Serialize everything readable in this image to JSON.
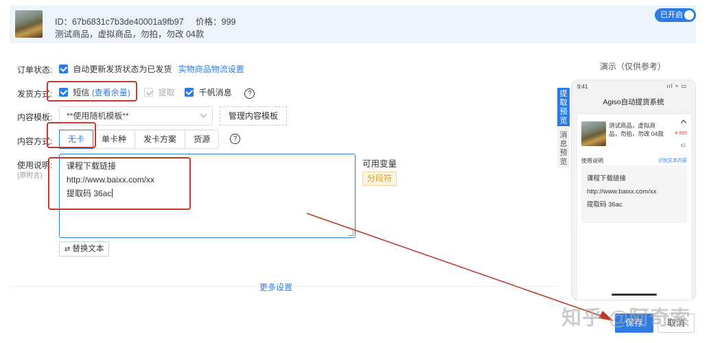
{
  "product": {
    "id_text": "ID：67b6831c7b3de40001a9fb97",
    "price_text": "价格：999",
    "desc": "测试商品，虚拟商品，勿拍，勿改 04款",
    "toggle_label": "已开启"
  },
  "order_status": {
    "label": "订单状态:",
    "checkbox_label": "自动更新发货状态为已发货",
    "link": "实物商品物流设置"
  },
  "ship_method": {
    "label": "发货方式:",
    "sms_label": "短信",
    "sms_link": "(查看余量)",
    "extract_label": "提取",
    "qianniu_label": "千帆消息",
    "help": "?"
  },
  "template": {
    "label": "内容模板:",
    "selected": "**使用随机模板**",
    "manage_button": "管理内容模板"
  },
  "content_method": {
    "label": "内容方式:",
    "options": [
      "无卡",
      "单卡种",
      "发卡方案",
      "货源"
    ],
    "selected_index": 0,
    "help": "?"
  },
  "instructions": {
    "label": "使用说明:",
    "sub_label": "(原附言)",
    "lines": [
      "课程下载链接",
      "http://www.baixx.com/xx",
      "提取码 36ac"
    ],
    "vars_label": "可用变量",
    "separator_tag": "分段符",
    "replace_button": "替换文本"
  },
  "more_settings": "更多设置",
  "preview": {
    "header": "演示（仅供参考）",
    "tab_extract": "提取预览",
    "tab_message": "消息预览",
    "time": "9:41",
    "signal": "ııl ≈ ▭",
    "app_title": "Agiso自动提货系统",
    "product_text": "测试商品，虚拟商品，勿拍，勿改 04款",
    "price": "¥ 999",
    "qty": "x1",
    "usage_label": "使用说明",
    "usage_link": "识别文本内容",
    "lines": [
      "课程下载链接",
      "http://www.baixx.com/xx",
      "提取码 36ac"
    ]
  },
  "actions": {
    "save": "保存",
    "cancel": "取消"
  },
  "watermark": "知乎 @阿奇索",
  "colors": {
    "accent": "#2d7be5",
    "annotation": "#c0392b",
    "tag_text": "#d4a018"
  }
}
